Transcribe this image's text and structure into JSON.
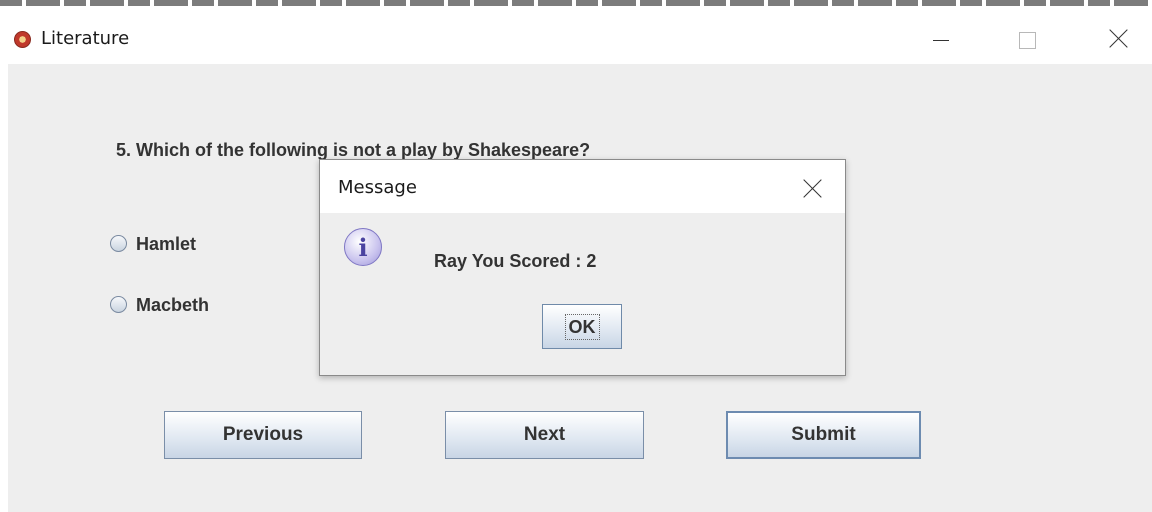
{
  "window": {
    "title": "Literature",
    "icons": {
      "app": "app-logo-icon",
      "minimize": "minimize-icon",
      "maximize": "maximize-icon",
      "close": "close-icon"
    }
  },
  "quiz": {
    "question": "5.  Which of the following is not a play by Shakespeare?",
    "options": [
      {
        "label": "Hamlet",
        "selected": false
      },
      {
        "label": "Macbeth",
        "selected": false
      }
    ]
  },
  "buttons": {
    "previous_label": "Previous",
    "next_label": "Next",
    "submit_label": "Submit"
  },
  "dialog": {
    "title": "Message",
    "message": "Ray You Scored : 2",
    "ok_label": "OK",
    "icon": "information-icon",
    "icon_glyph": "i"
  }
}
